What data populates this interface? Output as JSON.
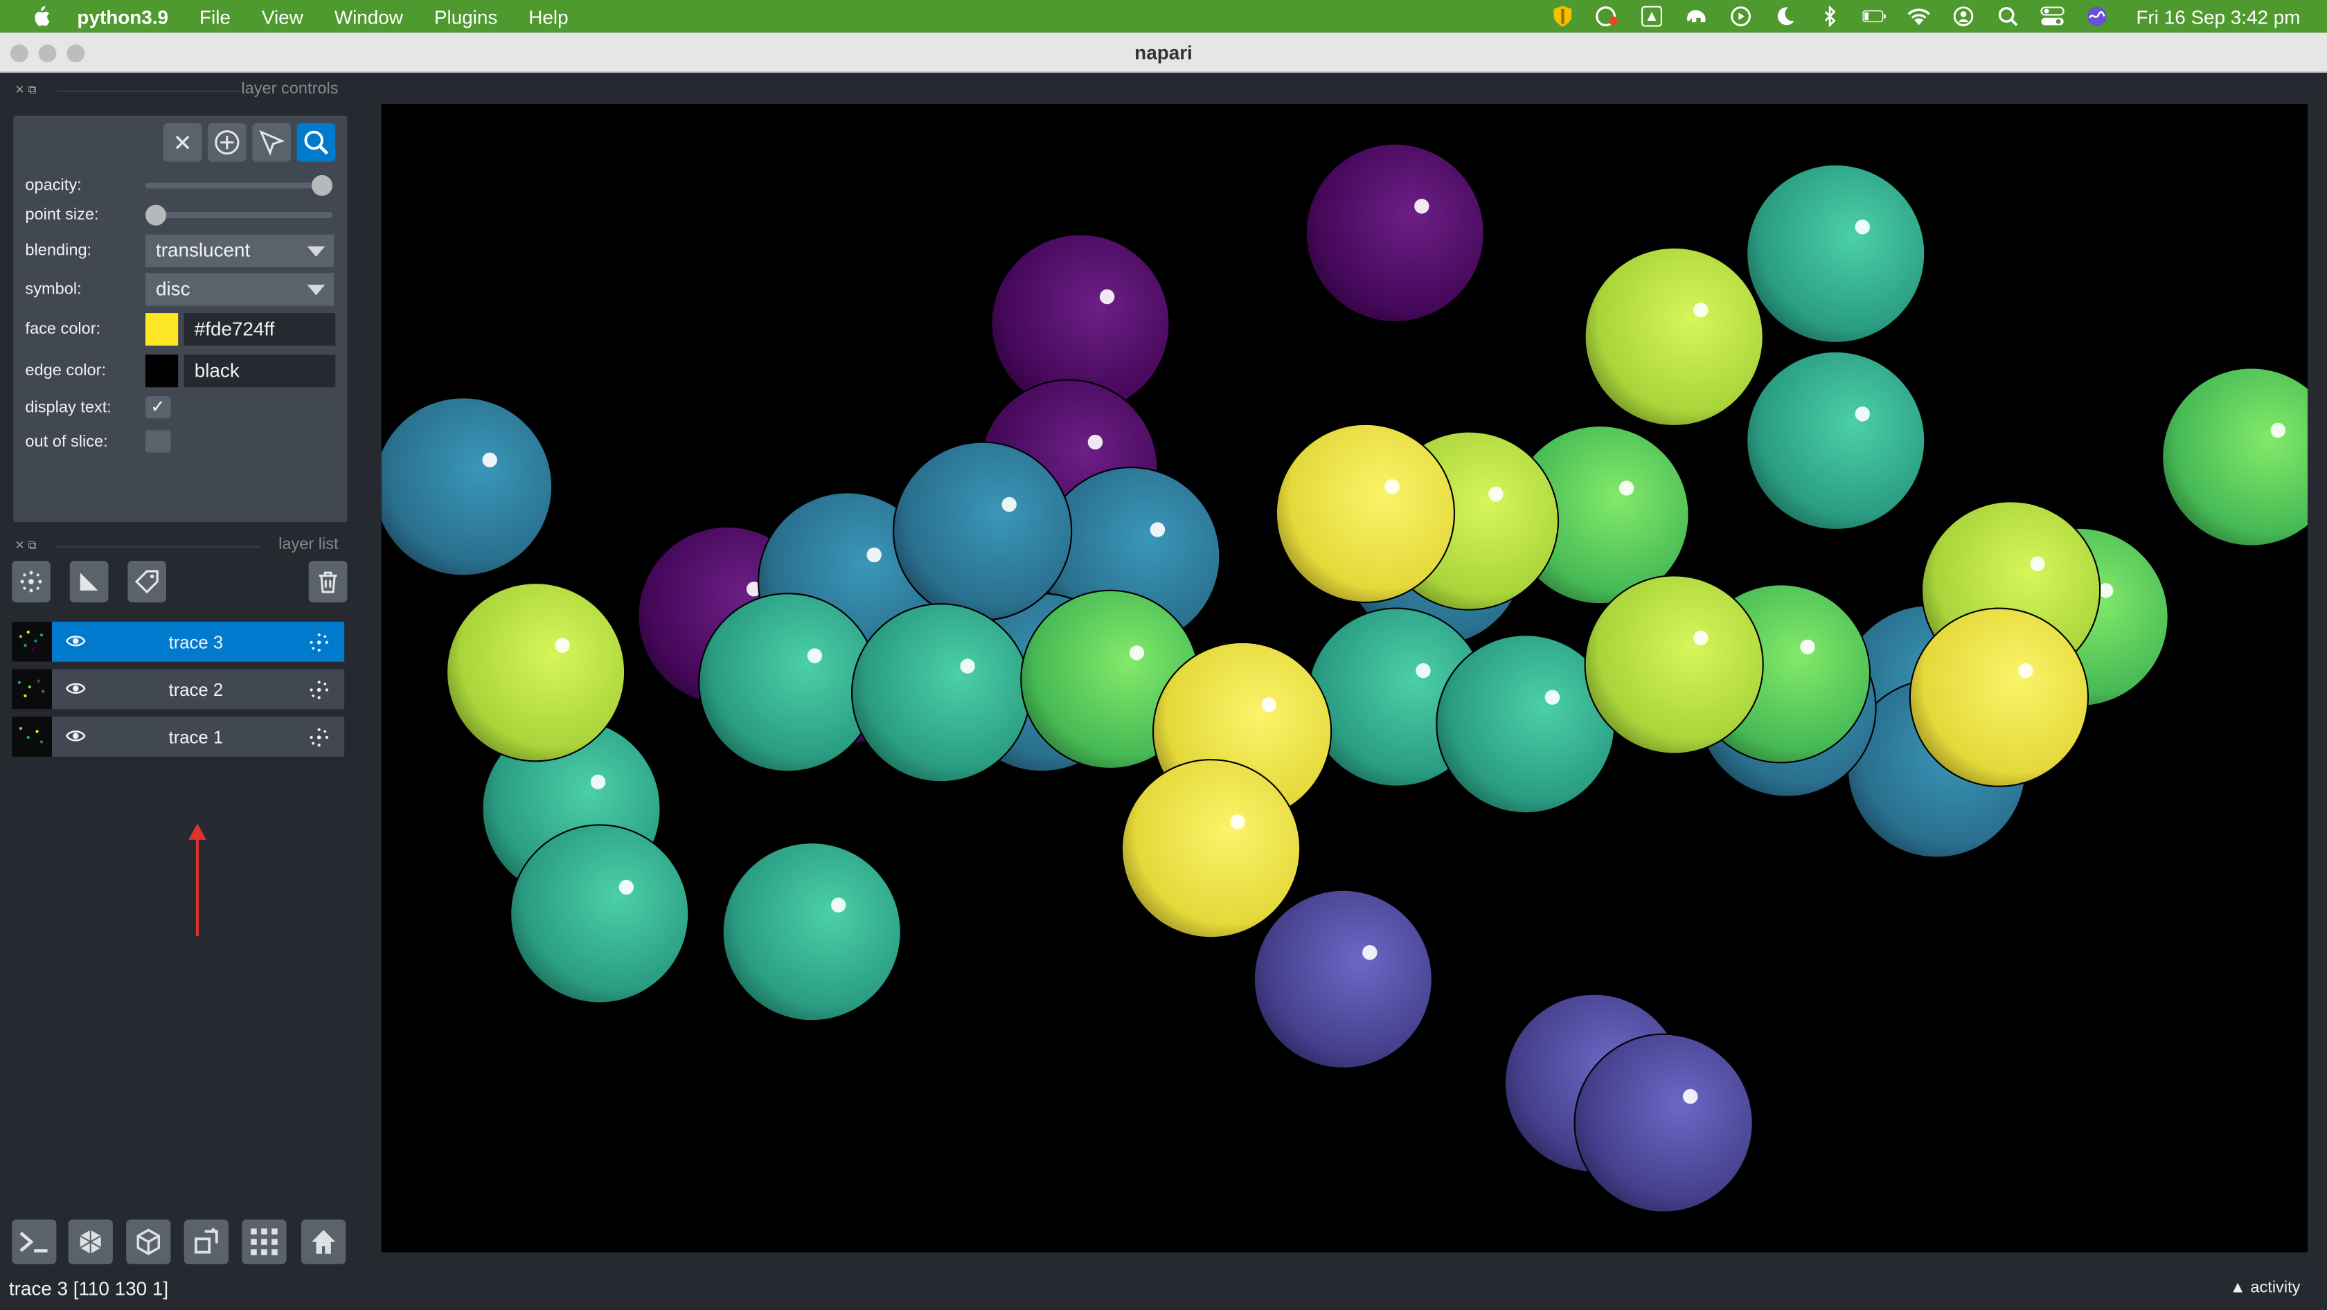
{
  "menubar": {
    "app_name": "python3.9",
    "menus": [
      "File",
      "View",
      "Window",
      "Plugins",
      "Help"
    ],
    "clock": "Fri 16 Sep  3:42 pm"
  },
  "window": {
    "title": "napari"
  },
  "layer_controls": {
    "header": "layer controls",
    "modes": [
      "close-icon",
      "add-point-icon",
      "select-icon",
      "zoom-icon"
    ],
    "active_mode": "zoom-icon",
    "opacity": {
      "label": "opacity:",
      "value": 1.0
    },
    "point_size": {
      "label": "point size:",
      "value": 0.0
    },
    "blending": {
      "label": "blending:",
      "value": "translucent"
    },
    "symbol": {
      "label": "symbol:",
      "value": "disc"
    },
    "face_color": {
      "label": "face color:",
      "value": "#fde724ff",
      "swatch": "#fde724"
    },
    "edge_color": {
      "label": "edge color:",
      "value": "black",
      "swatch": "#000000"
    },
    "display_text": {
      "label": "display text:",
      "checked": true
    },
    "out_of_slice": {
      "label": "out of slice:",
      "checked": false
    }
  },
  "layer_list": {
    "header": "layer list",
    "layers": [
      {
        "name": "trace 3",
        "selected": true,
        "visible": true
      },
      {
        "name": "trace 2",
        "selected": false,
        "visible": true
      },
      {
        "name": "trace 1",
        "selected": false,
        "visible": true
      }
    ]
  },
  "status": {
    "text": "trace 3 [110 130    1]",
    "activity": "activity"
  },
  "colors": {
    "menubar": "#4e9a2f",
    "panel": "#414851",
    "selected": "#007acc",
    "bg": "#262930"
  }
}
